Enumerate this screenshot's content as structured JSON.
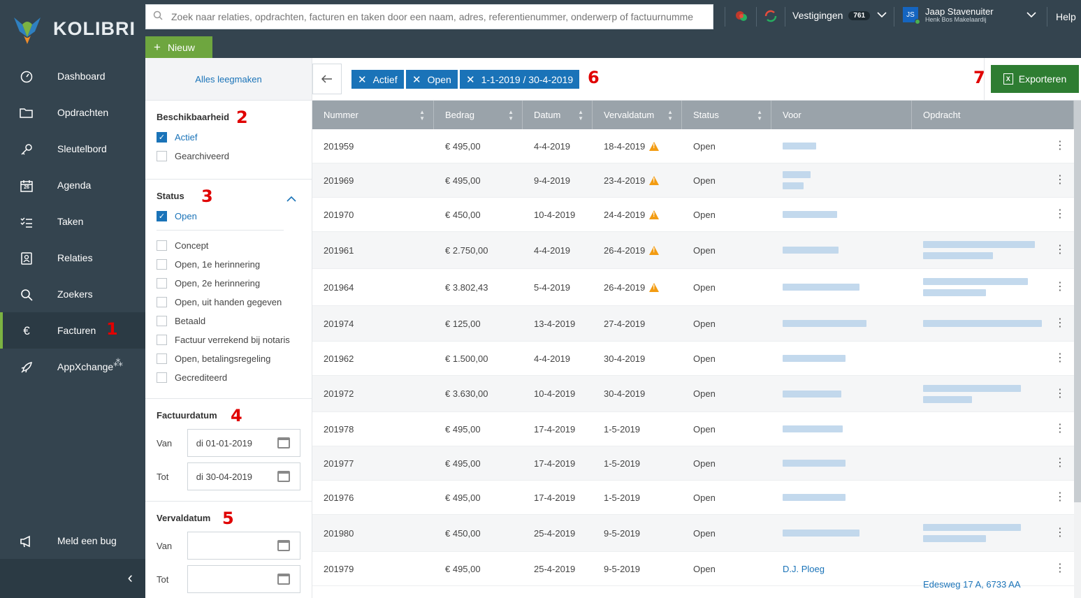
{
  "app": {
    "brand": "KOLIBRI"
  },
  "search": {
    "placeholder": "Zoek naar relaties, opdrachten, facturen en taken door een naam, adres, referentienummer, onderwerp of factuurnumme"
  },
  "topbar": {
    "vestigingen_label": "Vestigingen",
    "vestigingen_count": "761",
    "user_initials": "JS",
    "user_name": "Jaap Stavenuiter",
    "user_company": "Henk Bos Makelaardij",
    "help": "Help",
    "new_label": "Nieuw"
  },
  "sidebar": {
    "items": [
      {
        "label": "Dashboard",
        "icon": "dashboard-icon"
      },
      {
        "label": "Opdrachten",
        "icon": "folder-icon"
      },
      {
        "label": "Sleutelbord",
        "icon": "key-icon"
      },
      {
        "label": "Agenda",
        "icon": "calendar-icon",
        "day": "26"
      },
      {
        "label": "Taken",
        "icon": "checklist-icon"
      },
      {
        "label": "Relaties",
        "icon": "contacts-icon"
      },
      {
        "label": "Zoekers",
        "icon": "search-icon"
      },
      {
        "label": "Facturen",
        "icon": "euro-icon",
        "glyph": "€",
        "active": true
      },
      {
        "label": "AppXchange",
        "icon": "rocket-icon"
      }
    ],
    "bug_label": "Meld een bug"
  },
  "annotations": {
    "n1": "1",
    "n2": "2",
    "n3": "3",
    "n4": "4",
    "n5": "5",
    "n6": "6",
    "n7": "7"
  },
  "filters": {
    "clear_all": "Alles leegmaken",
    "availability": {
      "title": "Beschikbaarheid",
      "options": [
        {
          "label": "Actief",
          "checked": true
        },
        {
          "label": "Gearchiveerd",
          "checked": false
        }
      ]
    },
    "status": {
      "title": "Status",
      "selected": [
        {
          "label": "Open",
          "checked": true
        }
      ],
      "options": [
        {
          "label": "Concept"
        },
        {
          "label": "Open, 1e herinnering"
        },
        {
          "label": "Open, 2e herinnering"
        },
        {
          "label": "Open, uit handen gegeven"
        },
        {
          "label": "Betaald"
        },
        {
          "label": "Factuur verrekend bij notaris"
        },
        {
          "label": "Open, betalingsregeling"
        },
        {
          "label": "Gecrediteerd"
        }
      ]
    },
    "invoice_date": {
      "title": "Factuurdatum",
      "from_label": "Van",
      "to_label": "Tot",
      "from": "di 01-01-2019",
      "to": "di 30-04-2019"
    },
    "due_date": {
      "title": "Vervaldatum",
      "from_label": "Van",
      "to_label": "Tot",
      "from": "",
      "to": ""
    }
  },
  "chips": [
    "Actief",
    "Open",
    "1-1-2019 / 30-4-2019"
  ],
  "export_label": "Exporteren",
  "table": {
    "columns": [
      "Nummer",
      "Bedrag",
      "Datum",
      "Vervaldatum",
      "Status",
      "Voor",
      "Opdracht"
    ],
    "rows": [
      {
        "nummer": "201959",
        "bedrag": "€ 495,00",
        "datum": "4-4-2019",
        "verval": "18-4-2019",
        "warn": true,
        "status": "Open",
        "voor": "",
        "opdracht": ""
      },
      {
        "nummer": "201969",
        "bedrag": "€ 495,00",
        "datum": "9-4-2019",
        "verval": "23-4-2019",
        "warn": true,
        "status": "Open",
        "voor": "",
        "opdracht": ""
      },
      {
        "nummer": "201970",
        "bedrag": "€ 450,00",
        "datum": "10-4-2019",
        "verval": "24-4-2019",
        "warn": true,
        "status": "Open",
        "voor": "",
        "opdracht": ""
      },
      {
        "nummer": "201961",
        "bedrag": "€ 2.750,00",
        "datum": "4-4-2019",
        "verval": "26-4-2019",
        "warn": true,
        "status": "Open",
        "voor": "",
        "opdracht": ""
      },
      {
        "nummer": "201964",
        "bedrag": "€ 3.802,43",
        "datum": "5-4-2019",
        "verval": "26-4-2019",
        "warn": true,
        "status": "Open",
        "voor": "",
        "opdracht": ""
      },
      {
        "nummer": "201974",
        "bedrag": "€ 125,00",
        "datum": "13-4-2019",
        "verval": "27-4-2019",
        "warn": false,
        "status": "Open",
        "voor": "",
        "opdracht": ""
      },
      {
        "nummer": "201962",
        "bedrag": "€ 1.500,00",
        "datum": "4-4-2019",
        "verval": "30-4-2019",
        "warn": false,
        "status": "Open",
        "voor": "",
        "opdracht": ""
      },
      {
        "nummer": "201972",
        "bedrag": "€ 3.630,00",
        "datum": "10-4-2019",
        "verval": "30-4-2019",
        "warn": false,
        "status": "Open",
        "voor": "",
        "opdracht": ""
      },
      {
        "nummer": "201978",
        "bedrag": "€ 495,00",
        "datum": "17-4-2019",
        "verval": "1-5-2019",
        "warn": false,
        "status": "Open",
        "voor": "",
        "opdracht": ""
      },
      {
        "nummer": "201977",
        "bedrag": "€ 495,00",
        "datum": "17-4-2019",
        "verval": "1-5-2019",
        "warn": false,
        "status": "Open",
        "voor": "",
        "opdracht": ""
      },
      {
        "nummer": "201976",
        "bedrag": "€ 495,00",
        "datum": "17-4-2019",
        "verval": "1-5-2019",
        "warn": false,
        "status": "Open",
        "voor": "",
        "opdracht": ""
      },
      {
        "nummer": "201980",
        "bedrag": "€ 450,00",
        "datum": "25-4-2019",
        "verval": "9-5-2019",
        "warn": false,
        "status": "Open",
        "voor": "",
        "opdracht": ""
      },
      {
        "nummer": "201979",
        "bedrag": "€ 495,00",
        "datum": "25-4-2019",
        "verval": "9-5-2019",
        "warn": false,
        "status": "Open",
        "voor": "D.J. Ploeg",
        "opdracht": "Edesweg 17 A, 6733 AA"
      }
    ]
  },
  "colors": {
    "sidebar": "#34444f",
    "accent_green": "#6ea63f",
    "link_blue": "#1a73b8",
    "warning": "#f39c12",
    "export_green": "#2e7d32",
    "annotation_red": "#e00000"
  }
}
